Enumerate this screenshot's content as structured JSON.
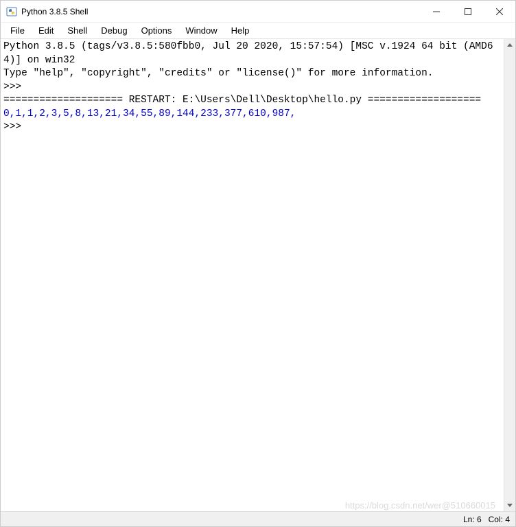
{
  "window": {
    "title": "Python 3.8.5 Shell"
  },
  "menu": {
    "file": "File",
    "edit": "Edit",
    "shell": "Shell",
    "debug": "Debug",
    "options": "Options",
    "window": "Window",
    "help": "Help"
  },
  "console": {
    "line1": "Python 3.8.5 (tags/v3.8.5:580fbb0, Jul 20 2020, 15:57:54) [MSC v.1924 64 bit (AMD64)] on win32",
    "line2": "Type \"help\", \"copyright\", \"credits\" or \"license()\" for more information.",
    "prompt1": ">>> ",
    "restart": "==================== RESTART: E:\\Users\\Dell\\Desktop\\hello.py ===================",
    "output": "0,1,1,2,3,5,8,13,21,34,55,89,144,233,377,610,987,",
    "prompt2": ">>> "
  },
  "status": {
    "ln": "Ln: 6",
    "col": "Col: 4"
  },
  "watermark": "https://blog.csdn.net/wer@510660015"
}
